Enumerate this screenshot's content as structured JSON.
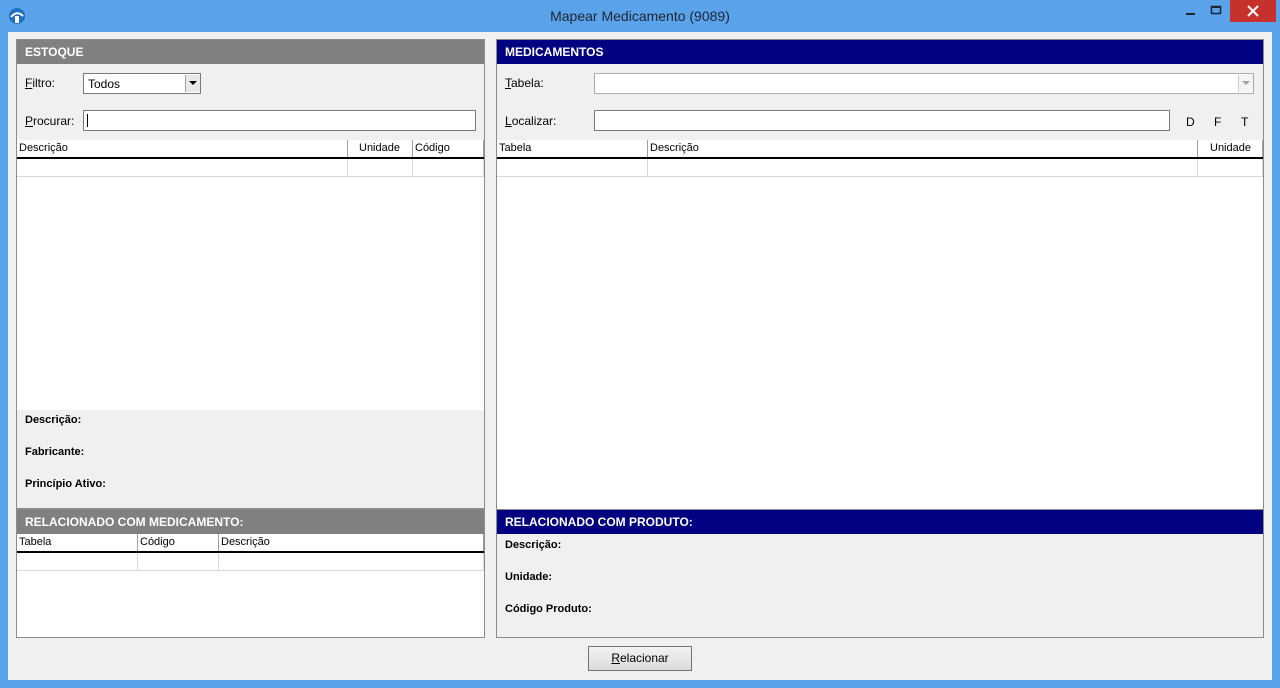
{
  "window": {
    "title": "Mapear Medicamento (9089)",
    "minimize": "–",
    "maximize": "□",
    "close": "✕"
  },
  "estoque": {
    "header": "ESTOQUE",
    "filtro_label_first": "F",
    "filtro_label_rest": "iltro:",
    "filtro_value": "Todos",
    "procurar_label_first": "P",
    "procurar_label_rest": "rocurar:",
    "procurar_value": "",
    "columns": [
      "Descrição",
      "Unidade",
      "Código"
    ],
    "details": {
      "descricao": "Descrição:",
      "fabricante": "Fabricante:",
      "principio": "Princípio Ativo:"
    }
  },
  "relacionado_medicamento": {
    "header": "RELACIONADO COM MEDICAMENTO:",
    "columns": [
      "Tabela",
      "Código",
      "Descrição"
    ]
  },
  "medicamentos": {
    "header": "MEDICAMENTOS",
    "tabela_label_first": "T",
    "tabela_label_rest": "abela:",
    "tabela_value": "",
    "localizar_label_first": "L",
    "localizar_label_rest": "ocalizar:",
    "localizar_value": "",
    "letters": [
      "D",
      "F",
      "T"
    ],
    "columns": [
      "Tabela",
      "Descrição",
      "Unidade"
    ]
  },
  "relacionado_produto": {
    "header": "RELACIONADO COM PRODUTO:",
    "details": {
      "descricao": "Descrição:",
      "unidade": "Unidade:",
      "codigo": "Código Produto:"
    }
  },
  "actions": {
    "relacionar_first": "R",
    "relacionar_rest": "elacionar"
  }
}
